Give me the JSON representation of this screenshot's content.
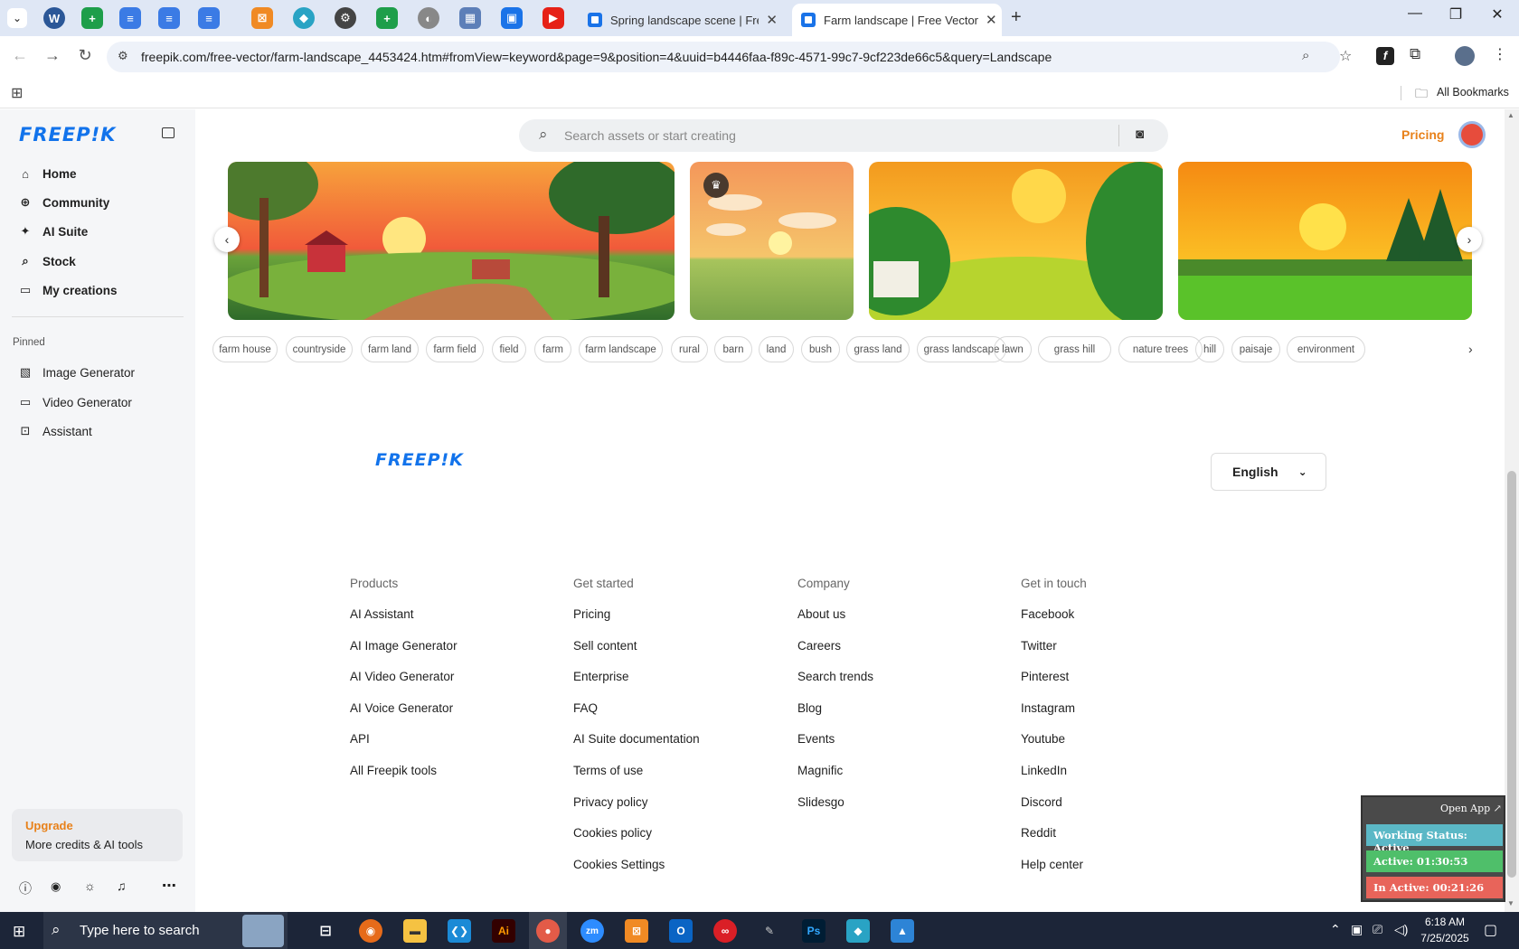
{
  "browser": {
    "tabs": [
      {
        "title": "Spring landscape scene | Free V"
      },
      {
        "title": "Farm landscape | Free Vector"
      }
    ],
    "url": "freepik.com/free-vector/farm-landscape_4453424.htm#fromView=keyword&page=9&position=4&uuid=b4446faa-f89c-4571-99c7-9cf223de66c5&query=Landscape",
    "bookmarks_label": "All Bookmarks"
  },
  "sidebar": {
    "logo": "FREEP!K",
    "items": [
      {
        "label": "Home",
        "icon": "home-icon"
      },
      {
        "label": "Community",
        "icon": "globe-icon"
      },
      {
        "label": "AI Suite",
        "icon": "sparkle-icon"
      },
      {
        "label": "Stock",
        "icon": "search-icon"
      },
      {
        "label": "My creations",
        "icon": "folder-icon"
      }
    ],
    "pinned_label": "Pinned",
    "pinned": [
      {
        "label": "Image Generator",
        "icon": "image-icon"
      },
      {
        "label": "Video Generator",
        "icon": "video-icon"
      },
      {
        "label": "Assistant",
        "icon": "assistant-icon"
      }
    ],
    "upgrade_title": "Upgrade",
    "upgrade_sub": "More credits & AI tools"
  },
  "header": {
    "search_placeholder": "Search assets or start creating",
    "pricing": "Pricing"
  },
  "tags": [
    "farm house",
    "countryside",
    "farm land",
    "farm field",
    "field",
    "farm",
    "farm landscape",
    "rural",
    "barn",
    "land",
    "bush",
    "grass land",
    "grass landscape",
    "lawn",
    "grass hill",
    "nature trees",
    "hill",
    "paisaje",
    "environment"
  ],
  "footer": {
    "logo": "FREEP!K",
    "language": "English",
    "columns": [
      {
        "heading": "Products",
        "links": [
          "AI Assistant",
          "AI Image Generator",
          "AI Video Generator",
          "AI Voice Generator",
          "API",
          "All Freepik tools"
        ]
      },
      {
        "heading": "Get started",
        "links": [
          "Pricing",
          "Sell content",
          "Enterprise",
          "FAQ",
          "AI Suite documentation",
          "Terms of use",
          "Privacy policy",
          "Cookies policy",
          "Cookies Settings"
        ]
      },
      {
        "heading": "Company",
        "links": [
          "About us",
          "Careers",
          "Search trends",
          "Blog",
          "Events",
          "Magnific",
          "Slidesgo"
        ]
      },
      {
        "heading": "Get in touch",
        "links": [
          "Facebook",
          "Twitter",
          "Pinterest",
          "Instagram",
          "Youtube",
          "LinkedIn",
          "Discord",
          "Reddit",
          "Help center"
        ]
      }
    ]
  },
  "status_widget": {
    "open_app": "Open App ↗",
    "working": "Working Status: Active",
    "active": "Active: 01:30:53",
    "inactive": "In Active: 00:21:26"
  },
  "taskbar": {
    "search_placeholder": "Type here to search",
    "time": "6:18 AM",
    "date": "7/25/2025"
  },
  "colors": {
    "brand": "#1273eb",
    "pricing": "#e8811a",
    "taskbar": "#1c2538"
  }
}
